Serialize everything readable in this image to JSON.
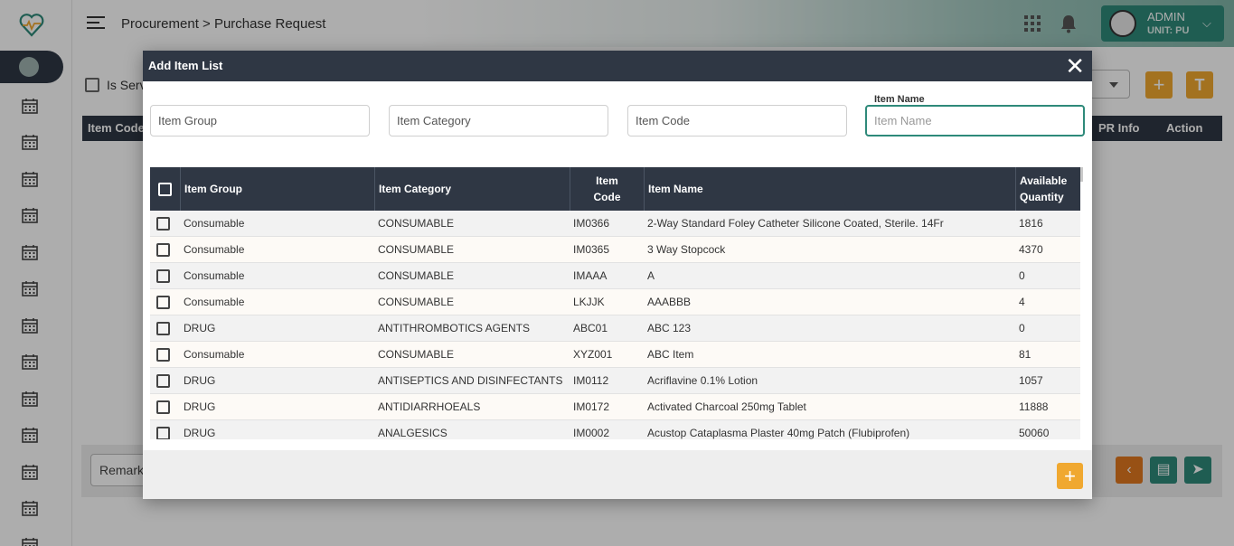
{
  "header": {
    "breadcrumb": "Procurement > Purchase Request",
    "user_name": "ADMIN",
    "user_unit": "UNIT: PU"
  },
  "background": {
    "is_service_label": "Is Serv",
    "table_headers": {
      "item_code": "Item Code",
      "pr_info": "PR Info",
      "action": "Action"
    },
    "remark_label": "Remark",
    "add_button": "+",
    "filter_button": "T"
  },
  "modal": {
    "title": "Add Item List",
    "close": "✕",
    "filters": {
      "item_group": {
        "placeholder": "Item Group"
      },
      "item_category": {
        "placeholder": "Item Category"
      },
      "item_code": {
        "placeholder": "Item Code"
      },
      "item_name": {
        "label": "Item Name",
        "placeholder": "Item Name"
      }
    },
    "columns": {
      "item_group": "Item Group",
      "item_category": "Item Category",
      "item_code_line1": "Item",
      "item_code_line2": "Code",
      "item_name": "Item Name",
      "available_line1": "Available",
      "available_line2": "Quantity"
    },
    "rows": [
      {
        "group": "Consumable",
        "category": "CONSUMABLE",
        "code": "IM0366",
        "name": "2-Way Standard Foley Catheter Silicone Coated, Sterile. 14Fr",
        "qty": "1816"
      },
      {
        "group": "Consumable",
        "category": "CONSUMABLE",
        "code": "IM0365",
        "name": "3 Way Stopcock",
        "qty": "4370"
      },
      {
        "group": "Consumable",
        "category": "CONSUMABLE",
        "code": "IMAAA",
        "name": "A",
        "qty": "0"
      },
      {
        "group": "Consumable",
        "category": "CONSUMABLE",
        "code": "LKJJK",
        "name": "AAABBB",
        "qty": "4"
      },
      {
        "group": "DRUG",
        "category": "ANTITHROMBOTICS AGENTS",
        "code": "ABC01",
        "name": "ABC 123",
        "qty": "0"
      },
      {
        "group": "Consumable",
        "category": "CONSUMABLE",
        "code": "XYZ001",
        "name": "ABC Item",
        "qty": "81"
      },
      {
        "group": "DRUG",
        "category": "ANTISEPTICS AND DISINFECTANTS",
        "code": "IM0112",
        "name": "Acriflavine 0.1% Lotion",
        "qty": "1057"
      },
      {
        "group": "DRUG",
        "category": "ANTIDIARRHOEALS",
        "code": "IM0172",
        "name": "Activated Charcoal 250mg Tablet",
        "qty": "11888"
      },
      {
        "group": "DRUG",
        "category": "ANALGESICS",
        "code": "IM0002",
        "name": "Acustop Cataplasma Plaster 40mg Patch (Flubiprofen)",
        "qty": "50060"
      }
    ],
    "add_button": "+"
  }
}
